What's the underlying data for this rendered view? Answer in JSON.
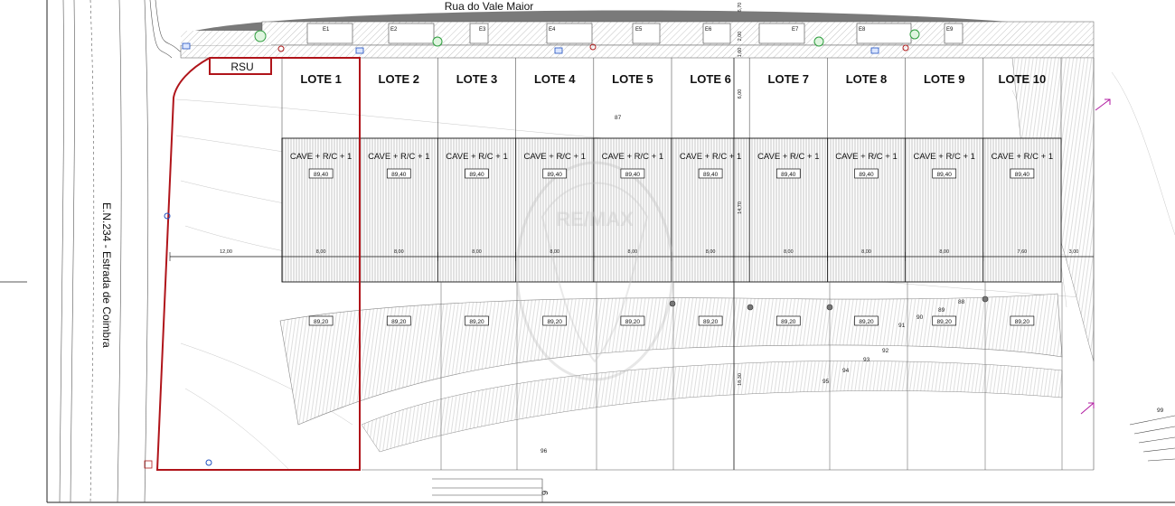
{
  "street_top": "Rua do Vale Maior",
  "road_left": "E.N.234 - Estrada de Coimbra",
  "rsu_label": "RSU",
  "watermark": "RE/MAX",
  "lots": [
    {
      "label": "LOTE 1",
      "building": "CAVE + R/C + 1",
      "elev_building": "89,40",
      "elev_rear": "89,20",
      "width": "8,00"
    },
    {
      "label": "LOTE 2",
      "building": "CAVE + R/C + 1",
      "elev_building": "89,40",
      "elev_rear": "89,20",
      "width": "8,00"
    },
    {
      "label": "LOTE 3",
      "building": "CAVE + R/C + 1",
      "elev_building": "89,40",
      "elev_rear": "89,20",
      "width": "8,00"
    },
    {
      "label": "LOTE 4",
      "building": "CAVE + R/C + 1",
      "elev_building": "89,40",
      "elev_rear": "89,20",
      "width": "8,00"
    },
    {
      "label": "LOTE 5",
      "building": "CAVE + R/C + 1",
      "elev_building": "89,40",
      "elev_rear": "89,20",
      "width": "8,00"
    },
    {
      "label": "LOTE 6",
      "building": "CAVE + R/C + 1",
      "elev_building": "89,40",
      "elev_rear": "89,20",
      "width": "8,00"
    },
    {
      "label": "LOTE 7",
      "building": "CAVE + R/C + 1",
      "elev_building": "89,40",
      "elev_rear": "89,20",
      "width": "8,00"
    },
    {
      "label": "LOTE 8",
      "building": "CAVE + R/C + 1",
      "elev_building": "89,40",
      "elev_rear": "89,20",
      "width": "8,00"
    },
    {
      "label": "LOTE 9",
      "building": "CAVE + R/C + 1",
      "elev_building": "89,40",
      "elev_rear": "89,20",
      "width": "8,00"
    },
    {
      "label": "LOTE 10",
      "building": "CAVE + R/C + 1",
      "elev_building": "89,40",
      "elev_rear": "89,20",
      "width": "7,60"
    }
  ],
  "parking": [
    "E1",
    "E2",
    "E3",
    "E4",
    "E5",
    "E6",
    "E7",
    "E8",
    "E9"
  ],
  "dimensions": {
    "left_setback": "12,00",
    "right_setback": "3,00",
    "depth_front": "6,00",
    "depth_building": "14,70",
    "depth_rear": "18,30",
    "street_a": "6,70",
    "street_b": "2,00",
    "street_c": "1,60"
  },
  "contours": [
    "87",
    "88",
    "89",
    "90",
    "91",
    "92",
    "93",
    "94",
    "95",
    "96",
    "99"
  ],
  "sheet_number": "9",
  "colors": {
    "boundary": "#b0141a",
    "line": "#1a1a1a",
    "grey_fill": "#7a7a7a",
    "hatch": "#9a9a9a",
    "accent_blue": "#1f4fbf",
    "accent_green": "#2e9e3e",
    "accent_magenta": "#b01aa0"
  }
}
